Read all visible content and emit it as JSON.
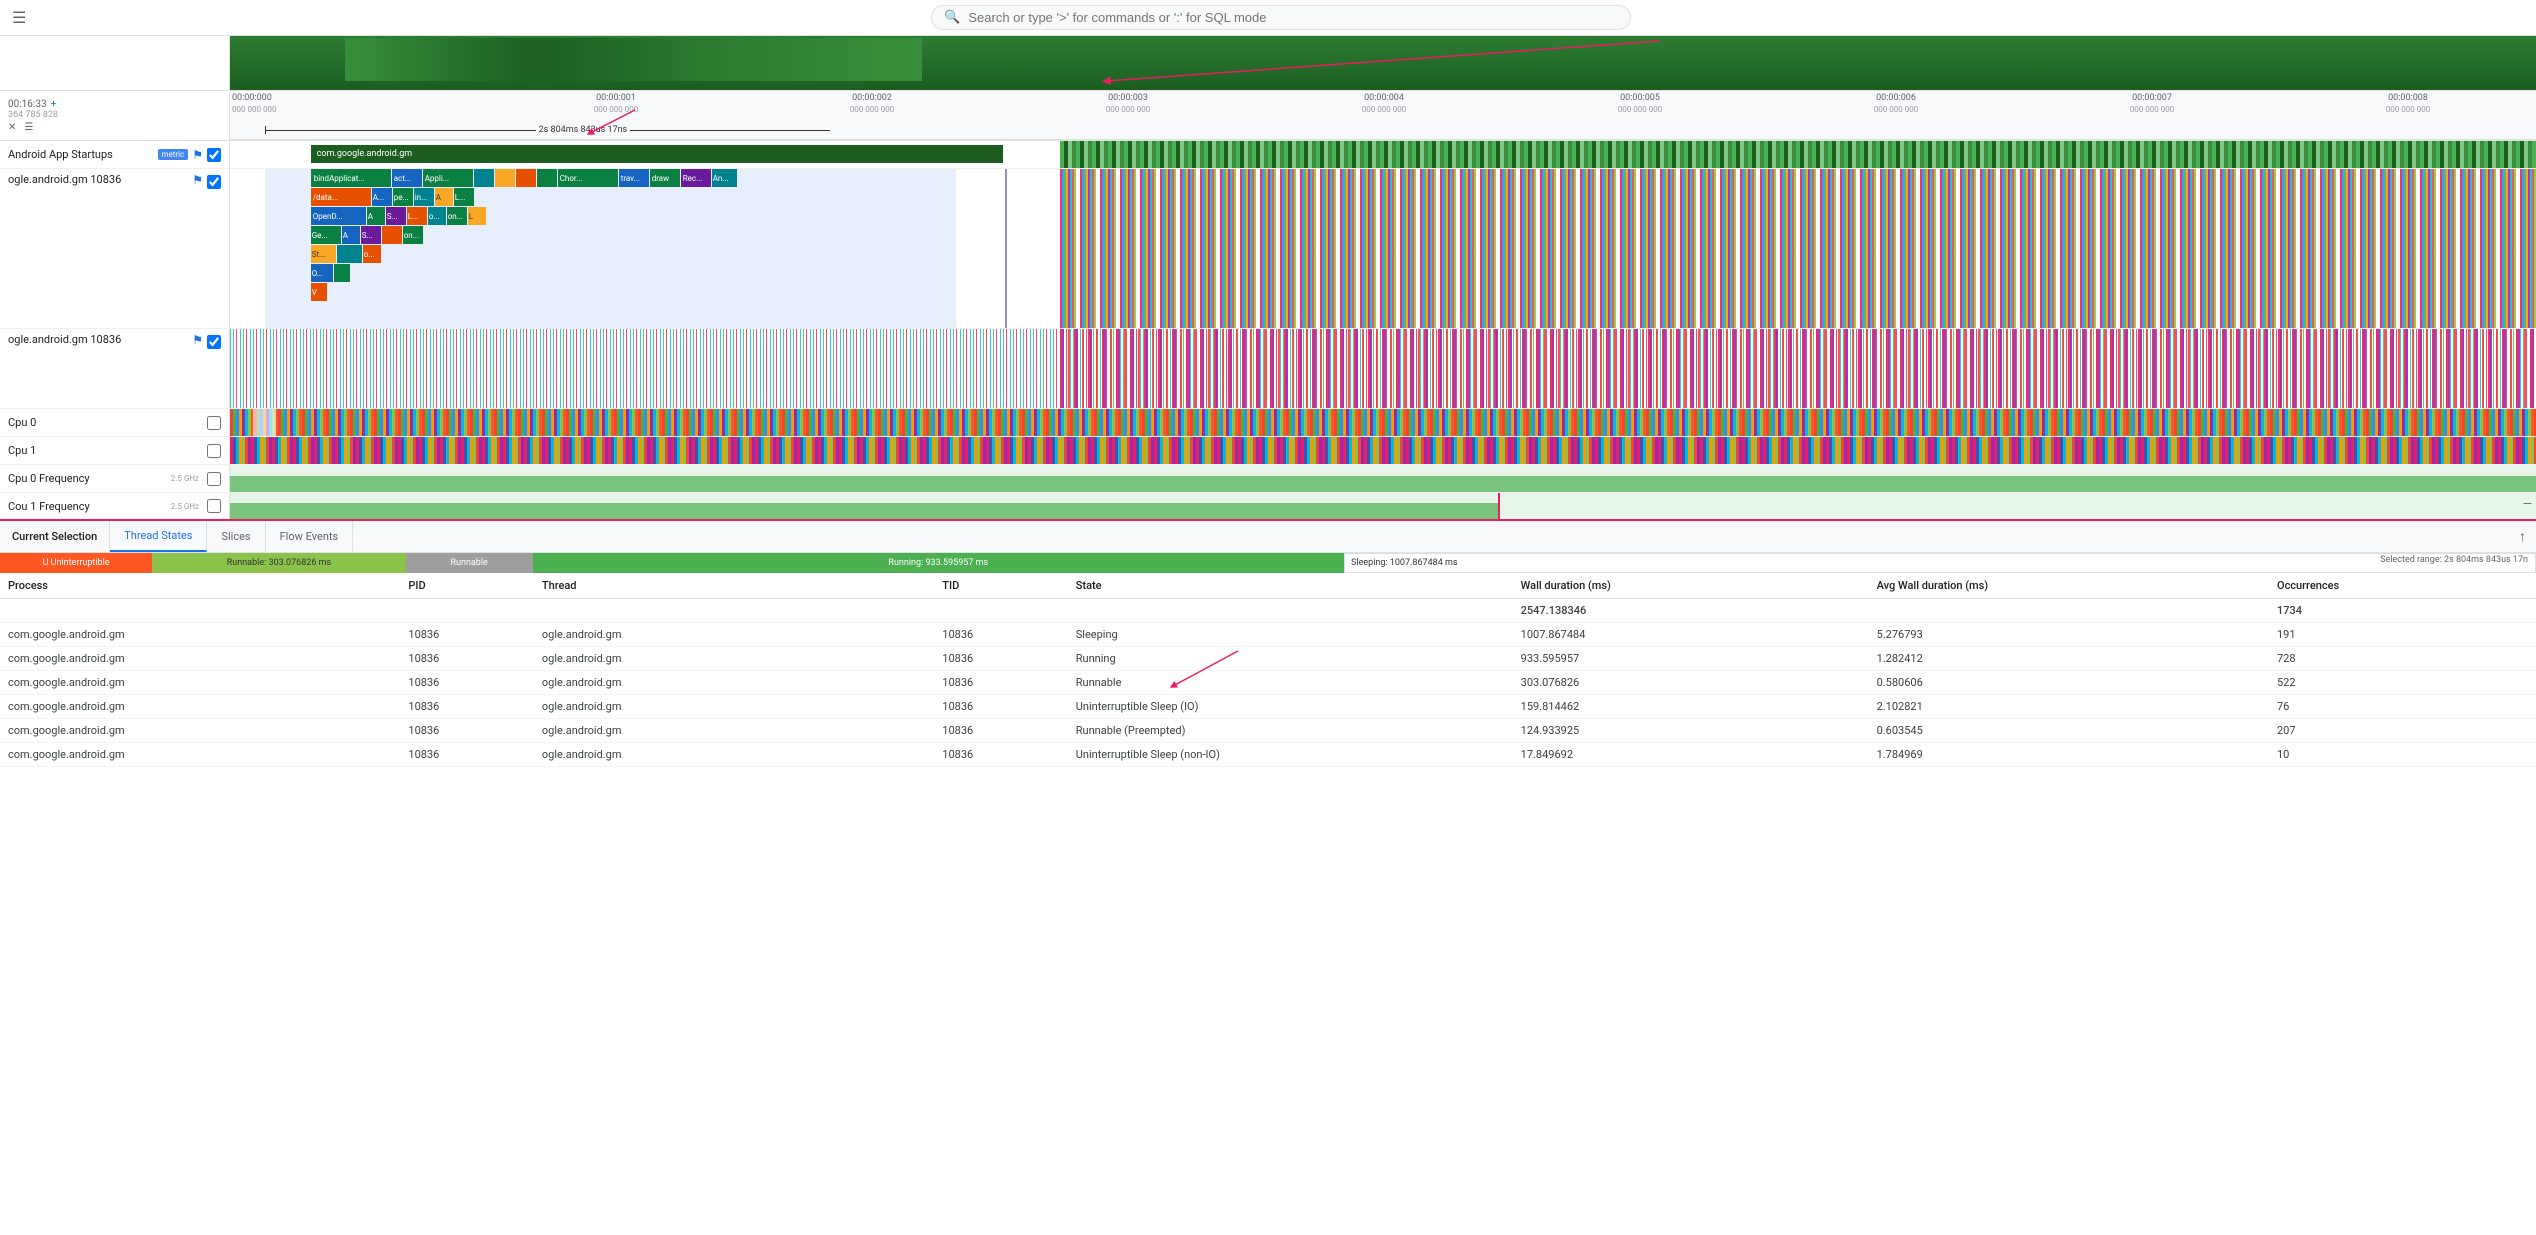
{
  "header": {
    "search_placeholder": "Search or type '>' for commands or ':' for SQL mode",
    "hamburger_label": "☰"
  },
  "timeline": {
    "current_time": "00:16:33",
    "plus_label": "+",
    "coordinates": "364 785 828",
    "x_label": "✕",
    "list_label": "☰",
    "duration_label": "2s 804ms 843us 17ns",
    "ruler_labels": [
      "00:00:000",
      "00:00:001",
      "00:00:002",
      "00:00:003",
      "00:00:004",
      "00:00:005",
      "00:00:006",
      "00:00:007",
      "00:00:008"
    ],
    "ruler_labels_sub": [
      "000 000 000",
      "000 000 000",
      "000 000 000",
      "000 000 000",
      "000 000 000",
      "000 000 000",
      "000 000 000",
      "000 000 000",
      "000 000 000"
    ]
  },
  "tracks": [
    {
      "id": "android-app-startups",
      "label": "Android App Startups",
      "has_metric": true,
      "metric_text": "metric",
      "has_pin": true,
      "has_checkbox": true,
      "height": "short"
    },
    {
      "id": "ogle-android-gm-10836-1",
      "label": "ogle.android.gm 10836",
      "has_pin": true,
      "has_checkbox": true,
      "height": "tall"
    },
    {
      "id": "ogle-android-gm-10836-2",
      "label": "ogle.android.gm 10836",
      "has_pin": true,
      "has_checkbox": true,
      "height": "medium"
    },
    {
      "id": "cpu0",
      "label": "Cpu 0",
      "has_checkbox": true,
      "height": "short"
    },
    {
      "id": "cpu1",
      "label": "Cpu 1",
      "has_checkbox": true,
      "height": "short"
    },
    {
      "id": "cpu0-freq",
      "label": "Cpu 0 Frequency",
      "has_checkbox": true,
      "height": "short",
      "freq_label": "2.5 GHz"
    },
    {
      "id": "cpu1-freq",
      "label": "Cou 1 Frequency",
      "has_checkbox": true,
      "height": "short",
      "freq_label": "2.5 GHz"
    }
  ],
  "tabs": {
    "current_selection": "Current Selection",
    "thread_states": "Thread States",
    "slices": "Slices",
    "flow_events": "Flow Events",
    "up_icon": "↑"
  },
  "state_bar": {
    "uninterruptible": {
      "label": "U  Uninterruptible",
      "width_pct": 6
    },
    "runnable": {
      "label": "Runnable: 303.076826 ms",
      "width_pct": 10
    },
    "runnable2": {
      "label": "Runnable",
      "width_pct": 5
    },
    "running": {
      "label": "Running: 933.595957 ms",
      "width_pct": 32
    },
    "sleeping": {
      "label": "Sleeping: 1007.867484 ms",
      "width_pct": 34
    },
    "selected_range": "Selected range: 2s 804ms 843us 17n"
  },
  "table": {
    "headers": [
      "Process",
      "PID",
      "Thread",
      "TID",
      "State",
      "Wall duration (ms)",
      "Avg Wall duration (ms)",
      "Occurrences"
    ],
    "total_row": {
      "wall": "2547.138346",
      "occurrences": "1734"
    },
    "rows": [
      {
        "process": "com.google.android.gm",
        "pid": "10836",
        "thread": "ogle.android.gm",
        "tid": "10836",
        "state": "Sleeping",
        "wall": "1007.867484",
        "avg_wall": "5.276793",
        "occurrences": "191"
      },
      {
        "process": "com.google.android.gm",
        "pid": "10836",
        "thread": "ogle.android.gm",
        "tid": "10836",
        "state": "Running",
        "wall": "933.595957",
        "avg_wall": "1.282412",
        "occurrences": "728"
      },
      {
        "process": "com.google.android.gm",
        "pid": "10836",
        "thread": "ogle.android.gm",
        "tid": "10836",
        "state": "Runnable",
        "wall": "303.076826",
        "avg_wall": "0.580606",
        "occurrences": "522"
      },
      {
        "process": "com.google.android.gm",
        "pid": "10836",
        "thread": "ogle.android.gm",
        "tid": "10836",
        "state": "Uninterruptible Sleep (IO)",
        "wall": "159.814462",
        "avg_wall": "2.102821",
        "occurrences": "76"
      },
      {
        "process": "com.google.android.gm",
        "pid": "10836",
        "thread": "ogle.android.gm",
        "tid": "10836",
        "state": "Runnable (Preempted)",
        "wall": "124.933925",
        "avg_wall": "0.603545",
        "occurrences": "207"
      },
      {
        "process": "com.google.android.gm",
        "pid": "10836",
        "thread": "ogle.android.gm",
        "tid": "10836",
        "state": "Uninterruptible Sleep (non-IO)",
        "wall": "17.849692",
        "avg_wall": "1.784969",
        "occurrences": "10"
      }
    ]
  },
  "flame_labels": {
    "row1": [
      "bindApplicat...",
      "act...",
      "Appli...",
      "Chor...",
      "trav...",
      "draw",
      "Rec...",
      "An..."
    ],
    "row2": [
      "/data...",
      "A...",
      "pe...",
      "in...",
      "A",
      "L...",
      ""
    ],
    "row3": [
      "OpenD...",
      "A",
      "S...",
      "L...",
      "o...",
      "on...",
      "L"
    ],
    "row4": [
      "Ge...",
      "A",
      "S...",
      "",
      "on...",
      ""
    ],
    "row5": [
      "St...",
      "",
      "o...",
      ""
    ],
    "row6": [
      "O...",
      ""
    ],
    "row7": [
      "V"
    ]
  }
}
